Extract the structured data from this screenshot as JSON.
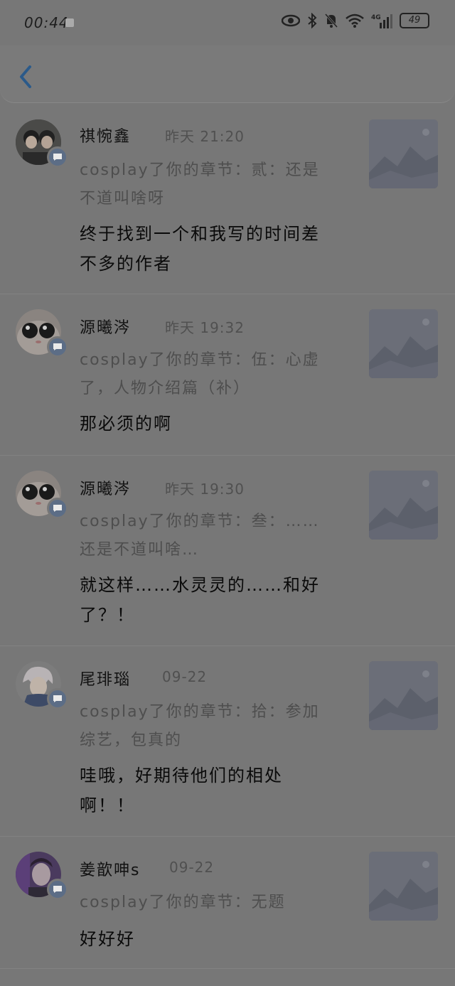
{
  "status_bar": {
    "time": "00:44",
    "battery": "49"
  },
  "header": {
    "back_icon": "chevron-left-icon"
  },
  "comments": [
    {
      "name": "祺惋鑫",
      "time": "昨天  21:20",
      "context": "cosplay了你的章节：贰：还是不道叫啥呀",
      "comment": "终于找到一个和我写的时间差不多的作者"
    },
    {
      "name": "源曦涔",
      "time": "昨天  19:32",
      "context": "cosplay了你的章节：伍：心虚了，人物介绍篇（补）",
      "comment": "那必须的啊"
    },
    {
      "name": "源曦涔",
      "time": "昨天  19:30",
      "context": "cosplay了你的章节：叁：……还是不道叫啥…",
      "comment": "就这样……水灵灵的……和好了？！"
    },
    {
      "name": "尾琲瑙",
      "time": "09-22",
      "context": "cosplay了你的章节：拾：参加综艺，包真的",
      "comment": "哇哦，好期待他们的相处啊！！"
    },
    {
      "name": "姜歆呻s",
      "time": "09-22",
      "context": "cosplay了你的章节：无题",
      "comment": "好好好"
    }
  ]
}
